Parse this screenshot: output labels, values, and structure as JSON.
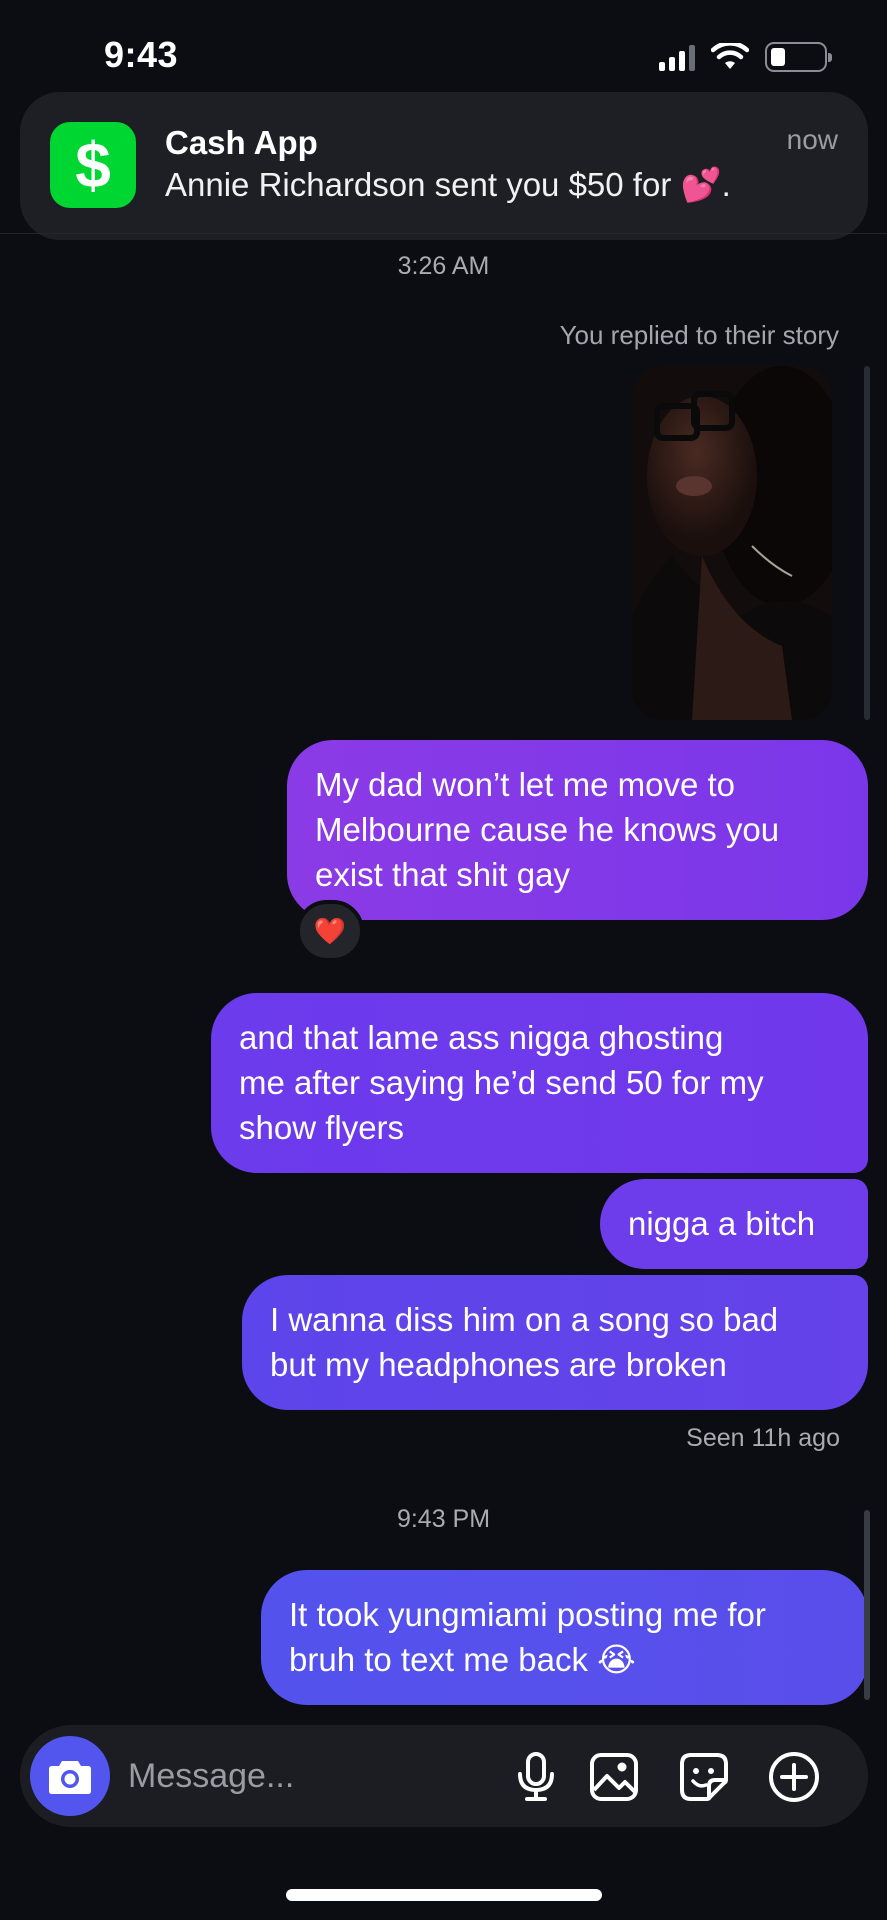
{
  "status_bar": {
    "time": "9:43"
  },
  "notification": {
    "app": "Cash App",
    "icon_glyph": "$",
    "body": "Annie Richardson sent you $50 for 💕.",
    "time": "now",
    "brand_color": "#00d632"
  },
  "thread": {
    "timestamp_1": "3:26 AM",
    "reply_caption": "You replied to their story",
    "messages": [
      {
        "lines": [
          "My dad won’t let me move to",
          "Melbourne cause he knows you",
          "exist that shit gay"
        ],
        "reaction": "❤️"
      },
      {
        "lines": [
          "and that lame ass nigga ghosting",
          "me after saying he’d send 50 for my",
          "show flyers"
        ]
      },
      {
        "lines": [
          "nigga a bitch"
        ]
      },
      {
        "lines": [
          "I wanna diss him on a song so bad",
          "but my headphones are broken"
        ]
      },
      {
        "lines": [
          "It took yungmiami posting me for",
          "bruh to text me back 😭"
        ]
      }
    ],
    "seen": "Seen 11h ago",
    "timestamp_2": "9:43 PM"
  },
  "composer": {
    "placeholder": "Message...",
    "icons": [
      "camera-icon",
      "microphone-icon",
      "gallery-icon",
      "sticker-icon",
      "add-icon"
    ],
    "accent_color": "#5256ee"
  }
}
